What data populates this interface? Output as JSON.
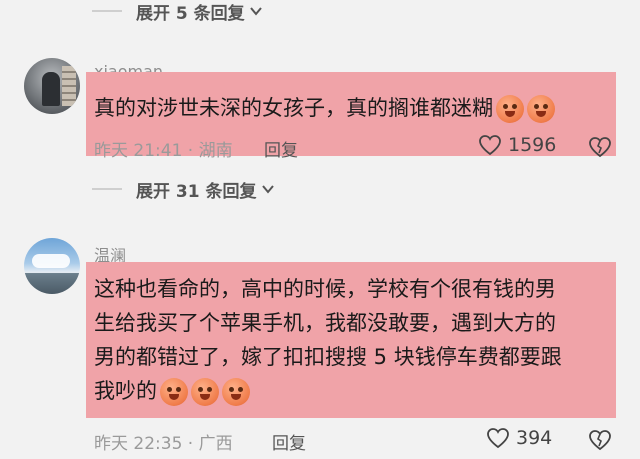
{
  "thread": {
    "expand_top": "展开 5 条回复",
    "expand_middle": "展开 31 条回复"
  },
  "comments": [
    {
      "username": "xiaoman",
      "text": "真的对涉世未深的女孩子，真的搁谁都迷糊",
      "emoji_count": 2,
      "time": "昨天 21:41",
      "location": "湖南",
      "reply_label": "回复",
      "likes": "1596"
    },
    {
      "username": "温澜",
      "lines": [
        "这种也看命的，高中的时候，学校有个很有钱的男",
        "生给我买了个苹果手机，我都没敢要，遇到大方的",
        "男的都错过了，嫁了扣扣搜搜 5 块钱停车费都要跟",
        "我吵的"
      ],
      "emoji_count": 3,
      "time": "昨天 22:35",
      "location": "广西",
      "reply_label": "回复",
      "likes": "394"
    }
  ],
  "colors": {
    "highlight": "#f0a3a8",
    "background": "#f2f2f2"
  },
  "icons": [
    "chevron-down-icon",
    "heart-icon",
    "dislike-heart-icon",
    "laughing-emoji"
  ]
}
